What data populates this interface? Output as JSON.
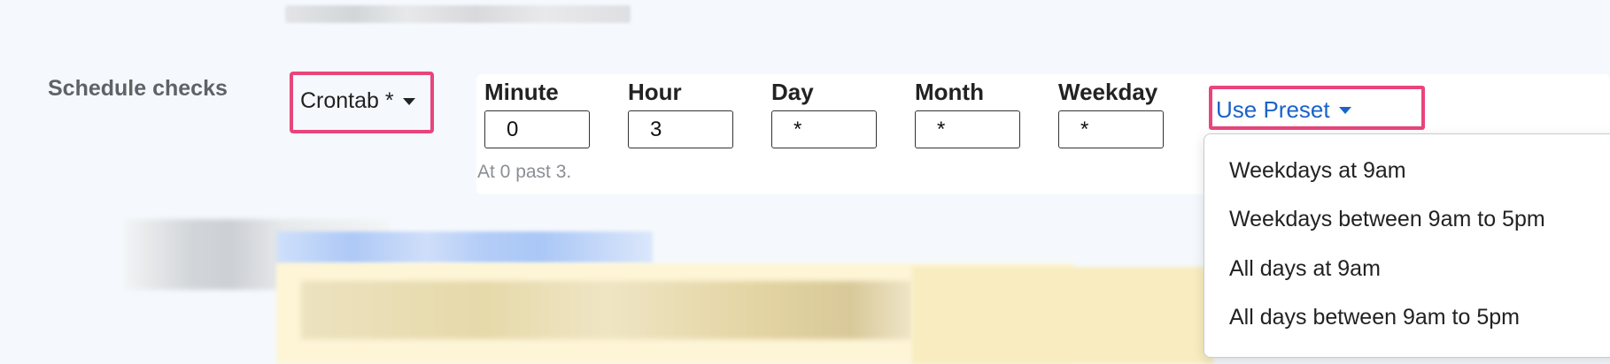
{
  "schedule": {
    "label": "Schedule checks",
    "mode_select": "Crontab *",
    "fields": [
      {
        "label": "Minute",
        "value": "0"
      },
      {
        "label": "Hour",
        "value": "3"
      },
      {
        "label": "Day",
        "value": "*"
      },
      {
        "label": "Month",
        "value": "*"
      },
      {
        "label": "Weekday",
        "value": "*"
      }
    ],
    "description": "At 0 past 3.",
    "preset": {
      "toggle_label": "Use Preset",
      "items": [
        "Weekdays at 9am",
        "Weekdays between 9am to 5pm",
        "All days at 9am",
        "All days between 9am to 5pm"
      ]
    }
  },
  "colors": {
    "highlight": "#e8457a",
    "link": "#1a63c9",
    "label_gray": "#5f6368"
  }
}
